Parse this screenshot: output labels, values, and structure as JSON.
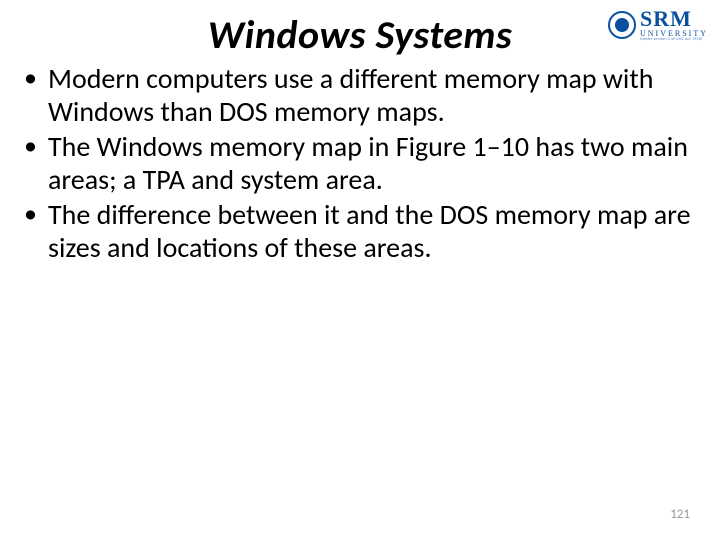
{
  "title": "Windows Systems",
  "logo": {
    "main": "SRM",
    "sub": "UNIVERSITY",
    "tagline": "(Under section 3 of UGC Act 1956)"
  },
  "bullets": [
    "Modern computers use a different memory map with Windows than DOS memory maps.",
    "The Windows memory map in Figure 1–10 has two main areas; a TPA and system area.",
    "The difference between it and the DOS memory map are sizes and locations of these areas."
  ],
  "page_number": "121"
}
